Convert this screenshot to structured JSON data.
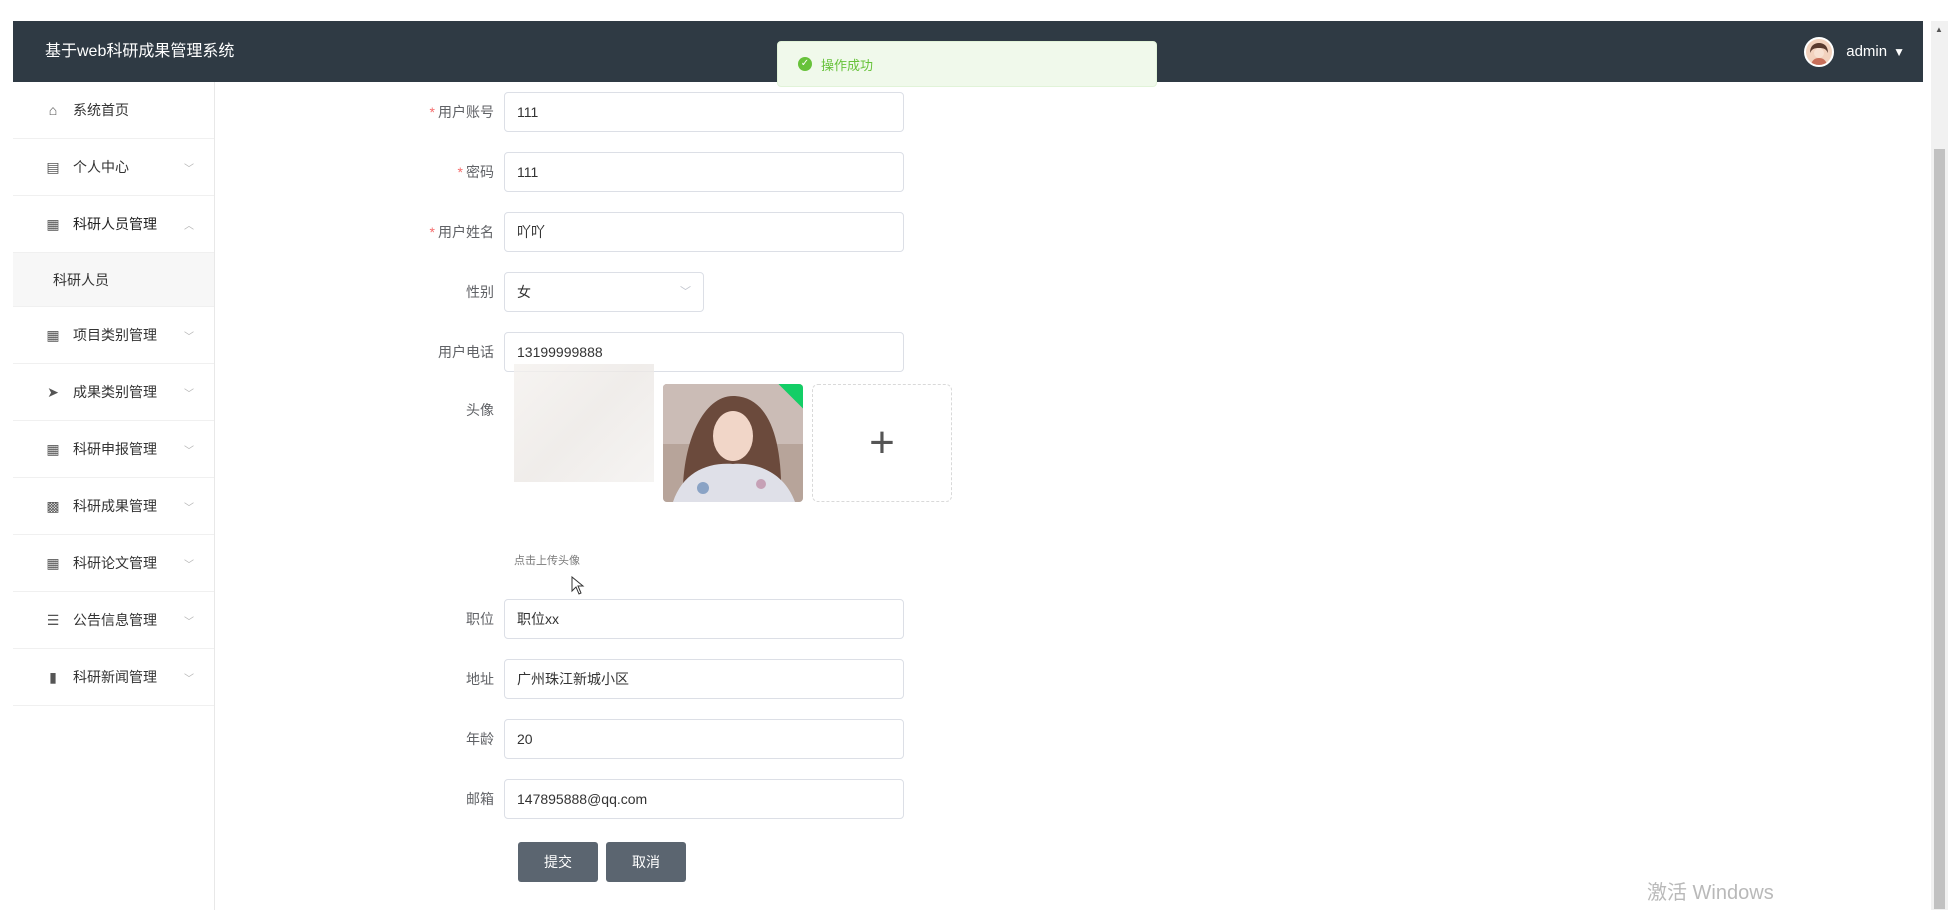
{
  "header": {
    "brand": "基于web科研成果管理系统",
    "user": "admin"
  },
  "toast": {
    "message": "操作成功"
  },
  "sidebar": {
    "items": [
      {
        "label": "系统首页",
        "icon": "home-icon"
      },
      {
        "label": "个人中心",
        "icon": "calendar-icon"
      },
      {
        "label": "科研人员管理",
        "icon": "grid-icon",
        "expanded": true,
        "children": [
          {
            "label": "科研人员"
          }
        ]
      },
      {
        "label": "项目类别管理",
        "icon": "grid-icon"
      },
      {
        "label": "成果类别管理",
        "icon": "send-icon"
      },
      {
        "label": "科研申报管理",
        "icon": "grid-icon"
      },
      {
        "label": "科研成果管理",
        "icon": "table-icon"
      },
      {
        "label": "科研论文管理",
        "icon": "grid-icon"
      },
      {
        "label": "公告信息管理",
        "icon": "sliders-icon"
      },
      {
        "label": "科研新闻管理",
        "icon": "bar-chart-icon"
      }
    ]
  },
  "form": {
    "account": {
      "label": "用户账号",
      "value": "111",
      "required": true
    },
    "password": {
      "label": "密码",
      "value": "111",
      "required": true
    },
    "name": {
      "label": "用户姓名",
      "value": "吖吖",
      "required": true
    },
    "gender": {
      "label": "性别",
      "value": "女"
    },
    "phone": {
      "label": "用户电话",
      "value": "13199999888"
    },
    "avatar": {
      "label": "头像",
      "tip": "点击上传头像"
    },
    "position": {
      "label": "职位",
      "value": "职位xx"
    },
    "address": {
      "label": "地址",
      "value": "广州珠江新城小区"
    },
    "age": {
      "label": "年龄",
      "value": "20"
    },
    "email": {
      "label": "邮箱",
      "value": "147895888@qq.com"
    },
    "submit_label": "提交",
    "cancel_label": "取消"
  },
  "watermark": "激活 Windows"
}
